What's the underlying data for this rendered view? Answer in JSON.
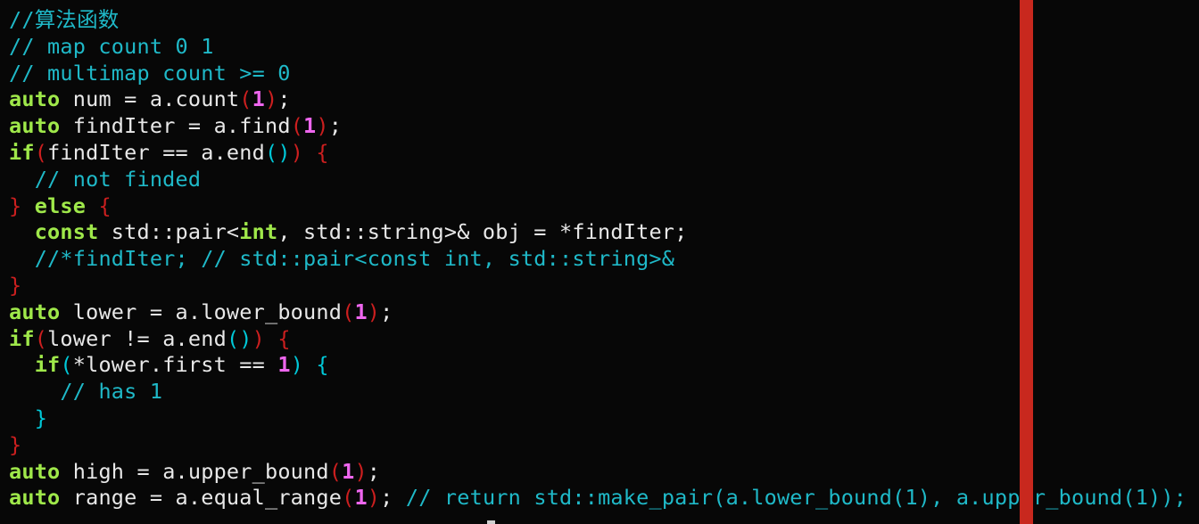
{
  "editor": {
    "background": "#070707",
    "colorcolumn_color": "#c8281e",
    "syntax_colors": {
      "keyword": "#9fe84a",
      "comment": "#1fb9c8",
      "number": "#ee66ee",
      "text": "#e8e8e8",
      "bracket_level0": "#cc1f1f",
      "bracket_level1": "#00c8d8",
      "bracket_level2": "#2fa52f"
    },
    "lines": [
      [
        {
          "t": "cm",
          "v": "//算法函数"
        }
      ],
      [
        {
          "t": "cm",
          "v": "// map count 0 1"
        }
      ],
      [
        {
          "t": "cm",
          "v": "// multimap count >= 0"
        }
      ],
      [
        {
          "t": "kw",
          "v": "auto"
        },
        {
          "t": "tx",
          "v": " num = a.count"
        },
        {
          "t": "br0",
          "v": "("
        },
        {
          "t": "num",
          "v": "1"
        },
        {
          "t": "br0",
          "v": ")"
        },
        {
          "t": "tx",
          "v": ";"
        }
      ],
      [
        {
          "t": "kw",
          "v": "auto"
        },
        {
          "t": "tx",
          "v": " findIter = a.find"
        },
        {
          "t": "br0",
          "v": "("
        },
        {
          "t": "num",
          "v": "1"
        },
        {
          "t": "br0",
          "v": ")"
        },
        {
          "t": "tx",
          "v": ";"
        }
      ],
      [
        {
          "t": "kw",
          "v": "if"
        },
        {
          "t": "br0",
          "v": "("
        },
        {
          "t": "tx",
          "v": "findIter == a.end"
        },
        {
          "t": "br1",
          "v": "()"
        },
        {
          "t": "br0",
          "v": ")"
        },
        {
          "t": "tx",
          "v": " "
        },
        {
          "t": "br0",
          "v": "{"
        }
      ],
      [
        {
          "t": "tx",
          "v": "  "
        },
        {
          "t": "cm",
          "v": "// not finded"
        }
      ],
      [
        {
          "t": "br0",
          "v": "}"
        },
        {
          "t": "tx",
          "v": " "
        },
        {
          "t": "kw",
          "v": "else"
        },
        {
          "t": "tx",
          "v": " "
        },
        {
          "t": "br0",
          "v": "{"
        }
      ],
      [
        {
          "t": "tx",
          "v": "  "
        },
        {
          "t": "kw",
          "v": "const"
        },
        {
          "t": "tx",
          "v": " std::pair<"
        },
        {
          "t": "kw",
          "v": "int"
        },
        {
          "t": "tx",
          "v": ", std::string>& obj = *findIter;"
        }
      ],
      [
        {
          "t": "tx",
          "v": "  "
        },
        {
          "t": "cm",
          "v": "//*findIter; // std::pair<const int, std::string>&"
        }
      ],
      [
        {
          "t": "br0",
          "v": "}"
        }
      ],
      [
        {
          "t": "kw",
          "v": "auto"
        },
        {
          "t": "tx",
          "v": " lower = a.lower_bound"
        },
        {
          "t": "br0",
          "v": "("
        },
        {
          "t": "num",
          "v": "1"
        },
        {
          "t": "br0",
          "v": ")"
        },
        {
          "t": "tx",
          "v": ";"
        }
      ],
      [
        {
          "t": "kw",
          "v": "if"
        },
        {
          "t": "br0",
          "v": "("
        },
        {
          "t": "tx",
          "v": "lower != a.end"
        },
        {
          "t": "br1",
          "v": "()"
        },
        {
          "t": "br0",
          "v": ")"
        },
        {
          "t": "tx",
          "v": " "
        },
        {
          "t": "br0",
          "v": "{"
        }
      ],
      [
        {
          "t": "tx",
          "v": "  "
        },
        {
          "t": "kw",
          "v": "if"
        },
        {
          "t": "br1",
          "v": "("
        },
        {
          "t": "tx",
          "v": "*lower.first == "
        },
        {
          "t": "num",
          "v": "1"
        },
        {
          "t": "br1",
          "v": ")"
        },
        {
          "t": "tx",
          "v": " "
        },
        {
          "t": "br1",
          "v": "{"
        }
      ],
      [
        {
          "t": "tx",
          "v": "    "
        },
        {
          "t": "cm",
          "v": "// has 1"
        }
      ],
      [
        {
          "t": "tx",
          "v": "  "
        },
        {
          "t": "br1",
          "v": "}"
        }
      ],
      [
        {
          "t": "br0",
          "v": "}"
        }
      ],
      [
        {
          "t": "kw",
          "v": "auto"
        },
        {
          "t": "tx",
          "v": " high = a.upper_bound"
        },
        {
          "t": "br0",
          "v": "("
        },
        {
          "t": "num",
          "v": "1"
        },
        {
          "t": "br0",
          "v": ")"
        },
        {
          "t": "tx",
          "v": ";"
        }
      ],
      [
        {
          "t": "kw",
          "v": "auto"
        },
        {
          "t": "tx",
          "v": " range = a.equal_range"
        },
        {
          "t": "br0",
          "v": "("
        },
        {
          "t": "num",
          "v": "1"
        },
        {
          "t": "br0",
          "v": ")"
        },
        {
          "t": "tx",
          "v": "; "
        },
        {
          "t": "cm",
          "v": "// return std::make_pair(a.lower_bound(1), a.upper_bound(1));"
        }
      ]
    ]
  }
}
